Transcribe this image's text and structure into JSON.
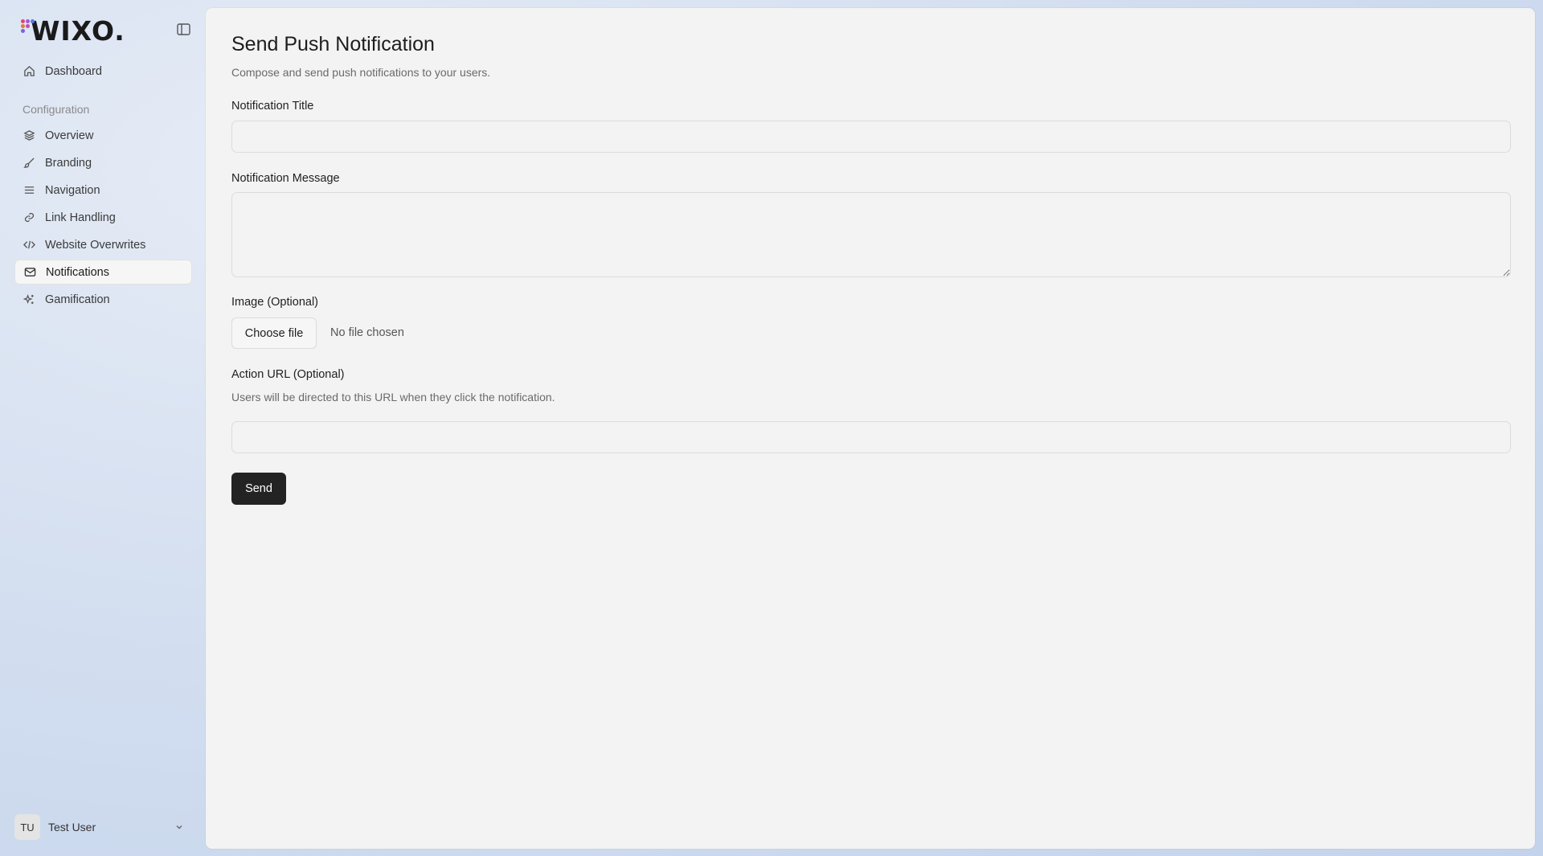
{
  "brand": {
    "name": "WIXO."
  },
  "sidebar": {
    "dashboard": {
      "label": "Dashboard",
      "icon": "home-icon"
    },
    "section_label": "Configuration",
    "items": [
      {
        "label": "Overview",
        "icon": "layers-icon"
      },
      {
        "label": "Branding",
        "icon": "brush-icon"
      },
      {
        "label": "Navigation",
        "icon": "menu-icon"
      },
      {
        "label": "Link Handling",
        "icon": "link-icon"
      },
      {
        "label": "Website Overwrites",
        "icon": "code-icon"
      },
      {
        "label": "Notifications",
        "icon": "mail-icon",
        "active": true
      },
      {
        "label": "Gamification",
        "icon": "sparkles-icon"
      }
    ],
    "user": {
      "initials": "TU",
      "name": "Test User"
    }
  },
  "main": {
    "title": "Send Push Notification",
    "subtitle": "Compose and send push notifications to your users.",
    "fields": {
      "title_label": "Notification Title",
      "title_value": "",
      "message_label": "Notification Message",
      "message_value": "",
      "image_label": "Image (Optional)",
      "choose_file": "Choose file",
      "file_status": "No file chosen",
      "action_label": "Action URL (Optional)",
      "action_help": "Users will be directed to this URL when they click the notification.",
      "action_value": ""
    },
    "send_label": "Send"
  },
  "colors": {
    "accent_dark": "#232323",
    "logo_dots": [
      "#e0447a",
      "#a35ad8",
      "#5a7be0",
      "#e07a3a",
      "#c24bb0",
      "#7b5fe0"
    ]
  }
}
